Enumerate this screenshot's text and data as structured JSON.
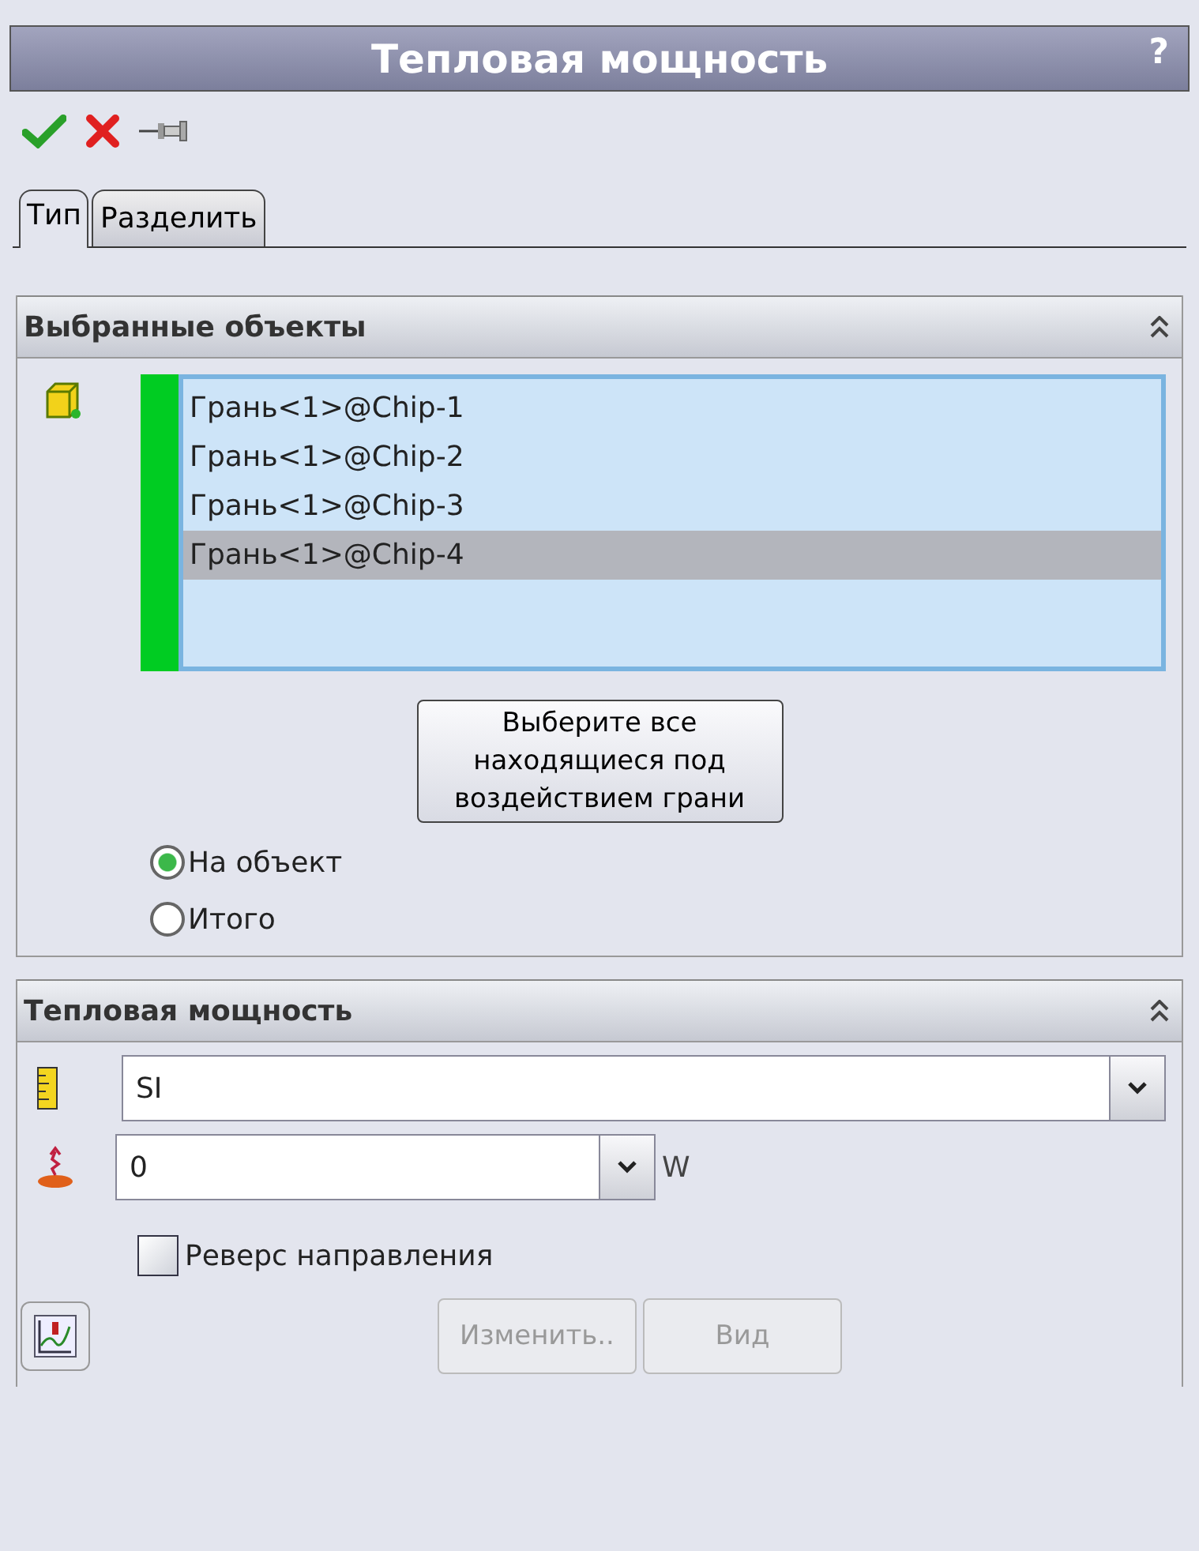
{
  "window": {
    "title": "Тепловая мощность",
    "help": "?"
  },
  "tabs": [
    {
      "label": "Тип",
      "selected": true
    },
    {
      "label": "Разделить",
      "selected": false
    }
  ],
  "selected_entities": {
    "title": "Выбранные объекты",
    "items": [
      {
        "label": "Грань<1>@Chip-1",
        "selected": false
      },
      {
        "label": "Грань<1>@Chip-2",
        "selected": false
      },
      {
        "label": "Грань<1>@Chip-3",
        "selected": false
      },
      {
        "label": "Грань<1>@Chip-4",
        "selected": true
      }
    ],
    "select_button": "Выберите все находящиеся под воздействием грани",
    "radios": [
      {
        "label": "На объект",
        "selected": true
      },
      {
        "label": "Итого",
        "selected": false
      }
    ]
  },
  "heat_power": {
    "title": "Тепловая мощность",
    "unit_system": "SI",
    "value": "0",
    "unit": "W",
    "reverse": {
      "label": "Реверс направления",
      "checked": false
    },
    "buttons": [
      {
        "label": "Изменить..",
        "disabled": true
      },
      {
        "label": "Вид",
        "disabled": true
      }
    ]
  }
}
